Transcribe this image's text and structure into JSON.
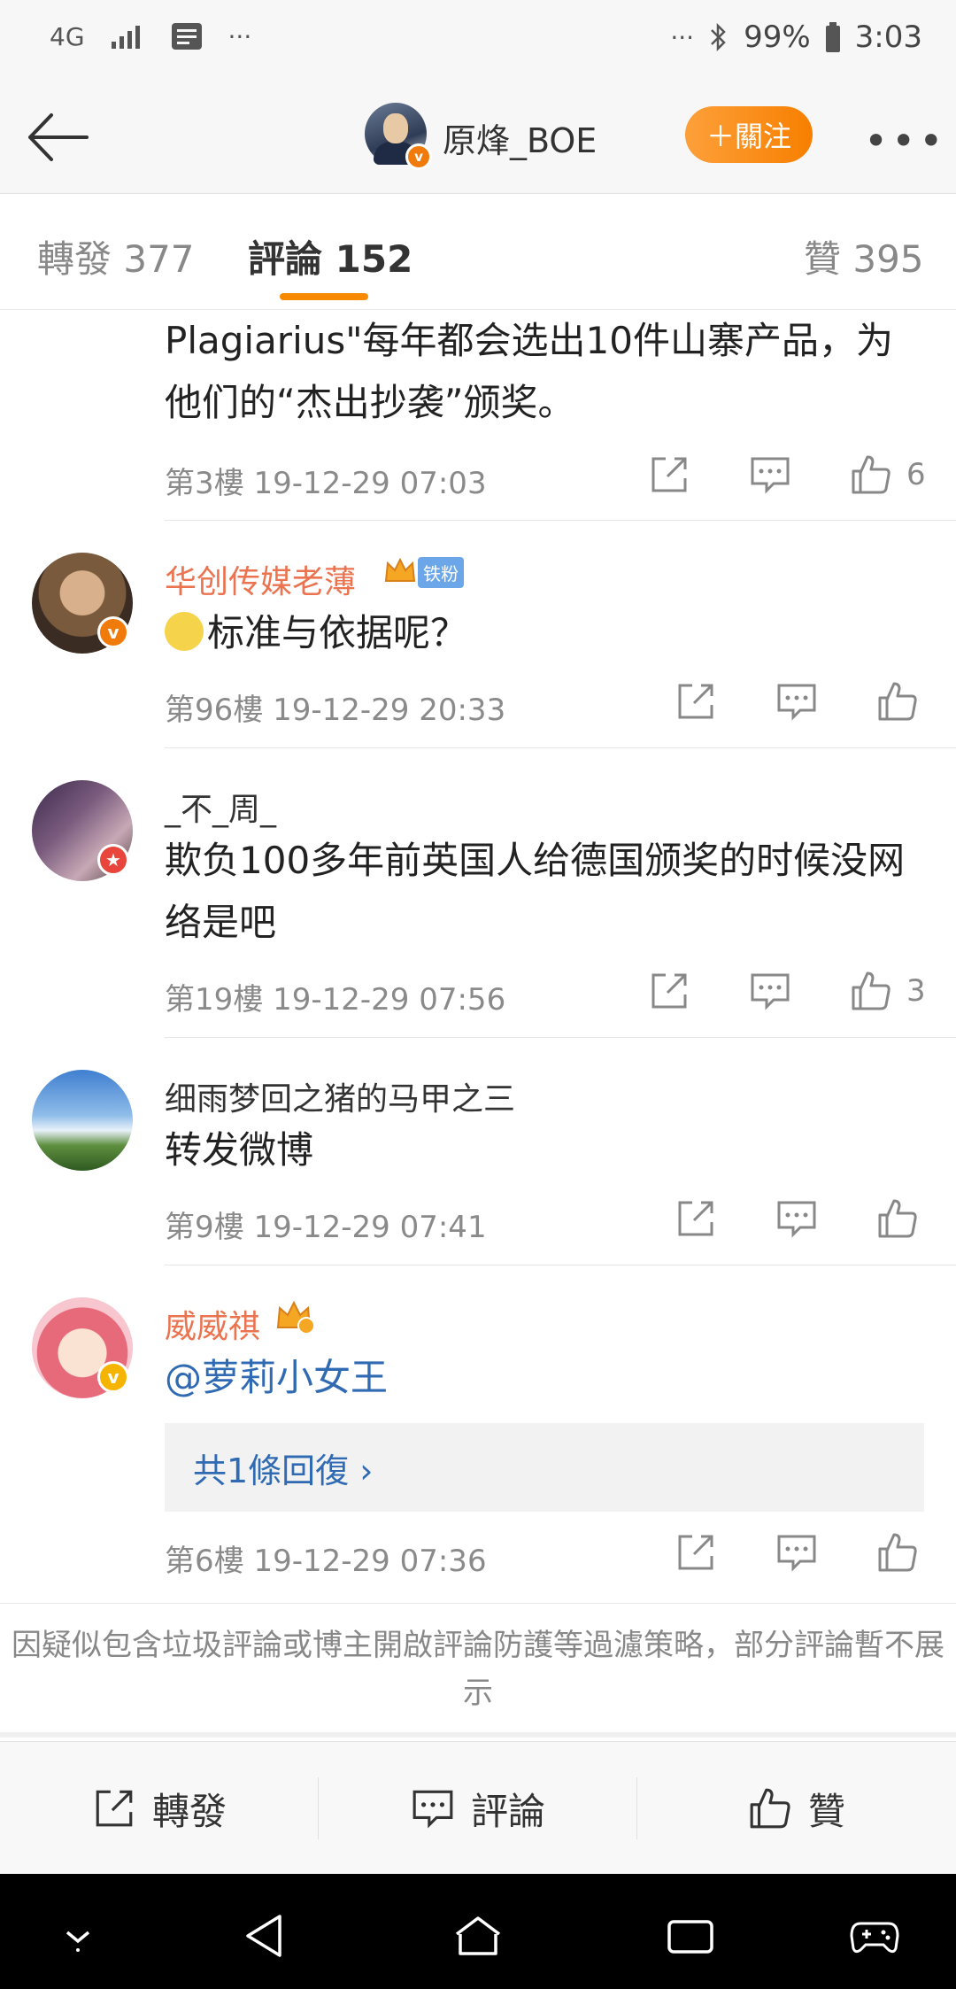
{
  "status_bar": {
    "network": "4G",
    "notif_dots": "···",
    "right_dots": "···",
    "battery": "99%",
    "time": "3:03"
  },
  "header": {
    "username": "原烽_BOE",
    "follow_label": "＋關注",
    "more": "•••"
  },
  "tabs": [
    {
      "label": "轉發 377"
    },
    {
      "label": "評論 152"
    },
    {
      "label": "贊 395"
    }
  ],
  "comments": [
    {
      "text": "Plagiarius\"每年都会选出10件山寨产品，为他们的“杰出抄袭”颁奖。",
      "floor": "第3樓",
      "time": "19-12-29 07:03",
      "likes": "6"
    },
    {
      "username": "华创传媒老薄",
      "fan_badge": "铁粉",
      "text": "标准与依据呢？",
      "floor": "第96樓",
      "time": "19-12-29 20:33",
      "likes": ""
    },
    {
      "username": "_不_周_",
      "text": "欺负100多年前英国人给德国颁奖的时候没网络是吧",
      "floor": "第19樓",
      "time": "19-12-29 07:56",
      "likes": "3"
    },
    {
      "username": "细雨梦回之猪的马甲之三",
      "text": "转发微博",
      "floor": "第9樓",
      "time": "19-12-29 07:41",
      "likes": ""
    },
    {
      "username": "威威祺",
      "text": "@萝莉小女王",
      "reply_summary": "共1條回復 ›",
      "floor": "第6樓",
      "time": "19-12-29 07:36",
      "likes": ""
    }
  ],
  "notice": "因疑似包含垃圾評論或博主開啟評論防護等過濾策略，部分評論暫不展示",
  "toolbar": {
    "repost": "轉發",
    "comment": "評論",
    "like": "贊"
  },
  "colors": {
    "accent_orange": "#f78a00",
    "username_orange": "#eb7350",
    "link_blue": "#2f6ab3"
  }
}
